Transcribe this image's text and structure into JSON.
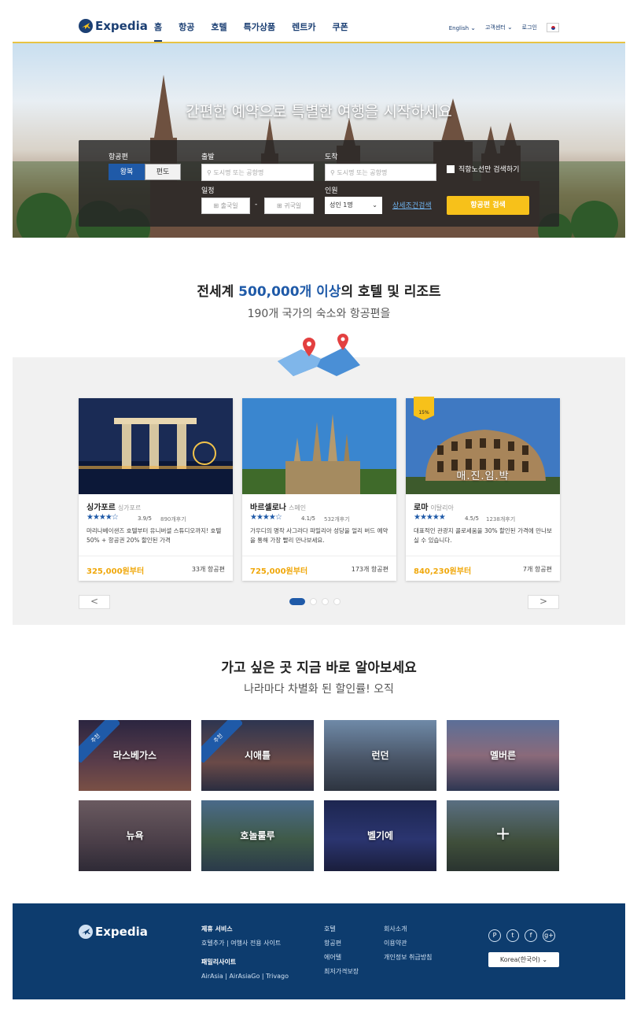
{
  "header": {
    "logo": "Expedia",
    "nav": [
      "홈",
      "항공",
      "호텔",
      "특가상품",
      "렌트카",
      "쿠폰"
    ],
    "language": "English",
    "support": "고객센터",
    "login": "로그인"
  },
  "hero": {
    "title": "간편한 예약으로 특별한 여행을 시작하세요",
    "search": {
      "type_label": "항공편",
      "roundtrip": "왕복",
      "oneway": "편도",
      "depart_label": "출발",
      "depart_placeholder": "도시명 또는 공항명",
      "arrive_label": "도착",
      "arrive_placeholder": "도시명 또는 공항명",
      "direct_only": "직항노선만 검색하기",
      "date_label": "일정",
      "date_out": "출국일",
      "date_dash": "-",
      "date_back": "귀국일",
      "people_label": "인원",
      "people_value": "성인 1명",
      "advanced": "상세조건검색",
      "submit": "항공편 검색"
    }
  },
  "section1": {
    "title_pre": "전세계 ",
    "title_hl": "500,000개 이상",
    "title_post": "의 호텔 및 리조트",
    "subtitle": "190개 국가의 숙소와 항공편을"
  },
  "cards": [
    {
      "city": "싱가포르",
      "country": "싱가포르",
      "stars": "★★★★☆",
      "rating": "3.9/5",
      "reviews": "890개후기",
      "desc": "마리나베이샌즈 호텔부터 유니버셜 스튜디오까지! 호텔 50% + 항공권 20% 할인된 가격",
      "price": "325,000원부터",
      "count": "33개 항공편"
    },
    {
      "city": "바르셀로나",
      "country": "스페인",
      "stars": "★★★★☆",
      "rating": "4.1/5",
      "reviews": "532개후기",
      "desc": "가우디의 명작 사그라다 파밀리아 성당을 얼리 버드 예약을 통해 가장 빨리 만나보세요.",
      "price": "725,000원부터",
      "count": "173개 항공편"
    },
    {
      "city": "로마",
      "country": "이탈리아",
      "stars": "★★★★★",
      "rating": "4.5/5",
      "reviews": "1238개후기",
      "desc": "대표적인 관광지 콜로세움을 30% 할인된 가격에 만나보실 수 있습니다.",
      "price": "840,230원부터",
      "count": "7개 항공편",
      "badge": "15%",
      "overlay": "매.진.임.박"
    }
  ],
  "carousel": {
    "prev": "<",
    "next": ">"
  },
  "section2": {
    "title": "가고 싶은 곳 지금 바로 알아보세요",
    "subtitle": "나라마다 차별화 된 할인률! 오직"
  },
  "tiles": [
    {
      "label": "라스베가스",
      "ribbon": "추천"
    },
    {
      "label": "시애틀",
      "ribbon": "추천"
    },
    {
      "label": "런던"
    },
    {
      "label": "멜버른"
    },
    {
      "label": "뉴욕"
    },
    {
      "label": "호놀룰루"
    },
    {
      "label": "벨기에"
    },
    {
      "label": "+"
    }
  ],
  "footer": {
    "logo": "Expedia",
    "partner_title": "제휴 서비스",
    "partner_links": "호텔추가 | 여행사 전용 사이트",
    "family_title": "패밀리사이트",
    "family_links": "AirAsia | AirAsiaGo | Trivago",
    "col1": [
      "호텔",
      "항공편",
      "에어텔",
      "최저가격보장"
    ],
    "col2": [
      "회사소개",
      "이용약관",
      "개인정보 취급방침"
    ],
    "socials": [
      "P",
      "t",
      "f",
      "g+"
    ],
    "country": "Korea(한국어) ⌄"
  },
  "colors": {
    "brand": "#1b3f73",
    "accent": "#f7c11a",
    "link": "#1f5aa8",
    "footer": "#0d3c6e"
  }
}
